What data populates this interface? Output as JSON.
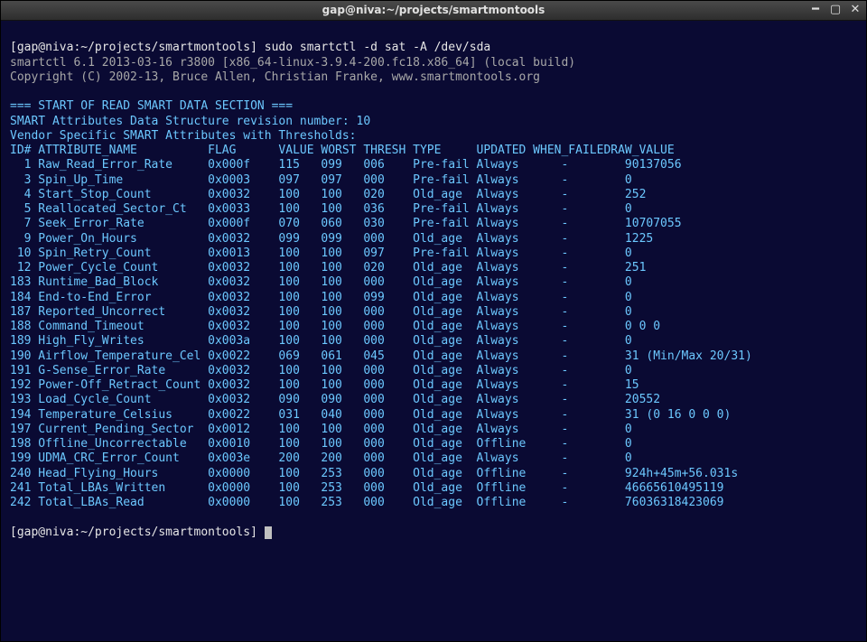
{
  "window": {
    "title": "gap@niva:~/projects/smartmontools"
  },
  "prompt": {
    "text": "[gap@niva:~/projects/smartmontools]",
    "command": "sudo smartctl -d sat -A /dev/sda"
  },
  "prompt2": {
    "text": "[gap@niva:~/projects/smartmontools]"
  },
  "version_line": "smartctl 6.1 2013-03-16 r3800 [x86_64-linux-3.9.4-200.fc18.x86_64] (local build)",
  "copyright_line": "Copyright (C) 2002-13, Bruce Allen, Christian Franke, www.smartmontools.org",
  "section_hdr": "=== START OF READ SMART DATA SECTION ===",
  "rev_line": "SMART Attributes Data Structure revision number: 10",
  "vendor_line": "Vendor Specific SMART Attributes with Thresholds:",
  "columns": {
    "c0": "ID#",
    "c1": "ATTRIBUTE_NAME",
    "c2": "FLAG",
    "c3": "VALUE",
    "c4": "WORST",
    "c5": "THRESH",
    "c6": "TYPE",
    "c7": "UPDATED",
    "c8": "WHEN_FAILED",
    "c9": "RAW_VALUE"
  },
  "rows": [
    {
      "id": "1",
      "name": "Raw_Read_Error_Rate",
      "flag": "0x000f",
      "value": "115",
      "worst": "099",
      "thresh": "006",
      "type": "Pre-fail",
      "updated": "Always",
      "when_failed": "-",
      "raw": "90137056"
    },
    {
      "id": "3",
      "name": "Spin_Up_Time",
      "flag": "0x0003",
      "value": "097",
      "worst": "097",
      "thresh": "000",
      "type": "Pre-fail",
      "updated": "Always",
      "when_failed": "-",
      "raw": "0"
    },
    {
      "id": "4",
      "name": "Start_Stop_Count",
      "flag": "0x0032",
      "value": "100",
      "worst": "100",
      "thresh": "020",
      "type": "Old_age",
      "updated": "Always",
      "when_failed": "-",
      "raw": "252"
    },
    {
      "id": "5",
      "name": "Reallocated_Sector_Ct",
      "flag": "0x0033",
      "value": "100",
      "worst": "100",
      "thresh": "036",
      "type": "Pre-fail",
      "updated": "Always",
      "when_failed": "-",
      "raw": "0"
    },
    {
      "id": "7",
      "name": "Seek_Error_Rate",
      "flag": "0x000f",
      "value": "070",
      "worst": "060",
      "thresh": "030",
      "type": "Pre-fail",
      "updated": "Always",
      "when_failed": "-",
      "raw": "10707055"
    },
    {
      "id": "9",
      "name": "Power_On_Hours",
      "flag": "0x0032",
      "value": "099",
      "worst": "099",
      "thresh": "000",
      "type": "Old_age",
      "updated": "Always",
      "when_failed": "-",
      "raw": "1225"
    },
    {
      "id": "10",
      "name": "Spin_Retry_Count",
      "flag": "0x0013",
      "value": "100",
      "worst": "100",
      "thresh": "097",
      "type": "Pre-fail",
      "updated": "Always",
      "when_failed": "-",
      "raw": "0"
    },
    {
      "id": "12",
      "name": "Power_Cycle_Count",
      "flag": "0x0032",
      "value": "100",
      "worst": "100",
      "thresh": "020",
      "type": "Old_age",
      "updated": "Always",
      "when_failed": "-",
      "raw": "251"
    },
    {
      "id": "183",
      "name": "Runtime_Bad_Block",
      "flag": "0x0032",
      "value": "100",
      "worst": "100",
      "thresh": "000",
      "type": "Old_age",
      "updated": "Always",
      "when_failed": "-",
      "raw": "0"
    },
    {
      "id": "184",
      "name": "End-to-End_Error",
      "flag": "0x0032",
      "value": "100",
      "worst": "100",
      "thresh": "099",
      "type": "Old_age",
      "updated": "Always",
      "when_failed": "-",
      "raw": "0"
    },
    {
      "id": "187",
      "name": "Reported_Uncorrect",
      "flag": "0x0032",
      "value": "100",
      "worst": "100",
      "thresh": "000",
      "type": "Old_age",
      "updated": "Always",
      "when_failed": "-",
      "raw": "0"
    },
    {
      "id": "188",
      "name": "Command_Timeout",
      "flag": "0x0032",
      "value": "100",
      "worst": "100",
      "thresh": "000",
      "type": "Old_age",
      "updated": "Always",
      "when_failed": "-",
      "raw": "0 0 0"
    },
    {
      "id": "189",
      "name": "High_Fly_Writes",
      "flag": "0x003a",
      "value": "100",
      "worst": "100",
      "thresh": "000",
      "type": "Old_age",
      "updated": "Always",
      "when_failed": "-",
      "raw": "0"
    },
    {
      "id": "190",
      "name": "Airflow_Temperature_Cel",
      "flag": "0x0022",
      "value": "069",
      "worst": "061",
      "thresh": "045",
      "type": "Old_age",
      "updated": "Always",
      "when_failed": "-",
      "raw": "31 (Min/Max 20/31)"
    },
    {
      "id": "191",
      "name": "G-Sense_Error_Rate",
      "flag": "0x0032",
      "value": "100",
      "worst": "100",
      "thresh": "000",
      "type": "Old_age",
      "updated": "Always",
      "when_failed": "-",
      "raw": "0"
    },
    {
      "id": "192",
      "name": "Power-Off_Retract_Count",
      "flag": "0x0032",
      "value": "100",
      "worst": "100",
      "thresh": "000",
      "type": "Old_age",
      "updated": "Always",
      "when_failed": "-",
      "raw": "15"
    },
    {
      "id": "193",
      "name": "Load_Cycle_Count",
      "flag": "0x0032",
      "value": "090",
      "worst": "090",
      "thresh": "000",
      "type": "Old_age",
      "updated": "Always",
      "when_failed": "-",
      "raw": "20552"
    },
    {
      "id": "194",
      "name": "Temperature_Celsius",
      "flag": "0x0022",
      "value": "031",
      "worst": "040",
      "thresh": "000",
      "type": "Old_age",
      "updated": "Always",
      "when_failed": "-",
      "raw": "31 (0 16 0 0 0)"
    },
    {
      "id": "197",
      "name": "Current_Pending_Sector",
      "flag": "0x0012",
      "value": "100",
      "worst": "100",
      "thresh": "000",
      "type": "Old_age",
      "updated": "Always",
      "when_failed": "-",
      "raw": "0"
    },
    {
      "id": "198",
      "name": "Offline_Uncorrectable",
      "flag": "0x0010",
      "value": "100",
      "worst": "100",
      "thresh": "000",
      "type": "Old_age",
      "updated": "Offline",
      "when_failed": "-",
      "raw": "0"
    },
    {
      "id": "199",
      "name": "UDMA_CRC_Error_Count",
      "flag": "0x003e",
      "value": "200",
      "worst": "200",
      "thresh": "000",
      "type": "Old_age",
      "updated": "Always",
      "when_failed": "-",
      "raw": "0"
    },
    {
      "id": "240",
      "name": "Head_Flying_Hours",
      "flag": "0x0000",
      "value": "100",
      "worst": "253",
      "thresh": "000",
      "type": "Old_age",
      "updated": "Offline",
      "when_failed": "-",
      "raw": "924h+45m+56.031s"
    },
    {
      "id": "241",
      "name": "Total_LBAs_Written",
      "flag": "0x0000",
      "value": "100",
      "worst": "253",
      "thresh": "000",
      "type": "Old_age",
      "updated": "Offline",
      "when_failed": "-",
      "raw": "46665610495119"
    },
    {
      "id": "242",
      "name": "Total_LBAs_Read",
      "flag": "0x0000",
      "value": "100",
      "worst": "253",
      "thresh": "000",
      "type": "Old_age",
      "updated": "Offline",
      "when_failed": "-",
      "raw": "76036318423069"
    }
  ]
}
